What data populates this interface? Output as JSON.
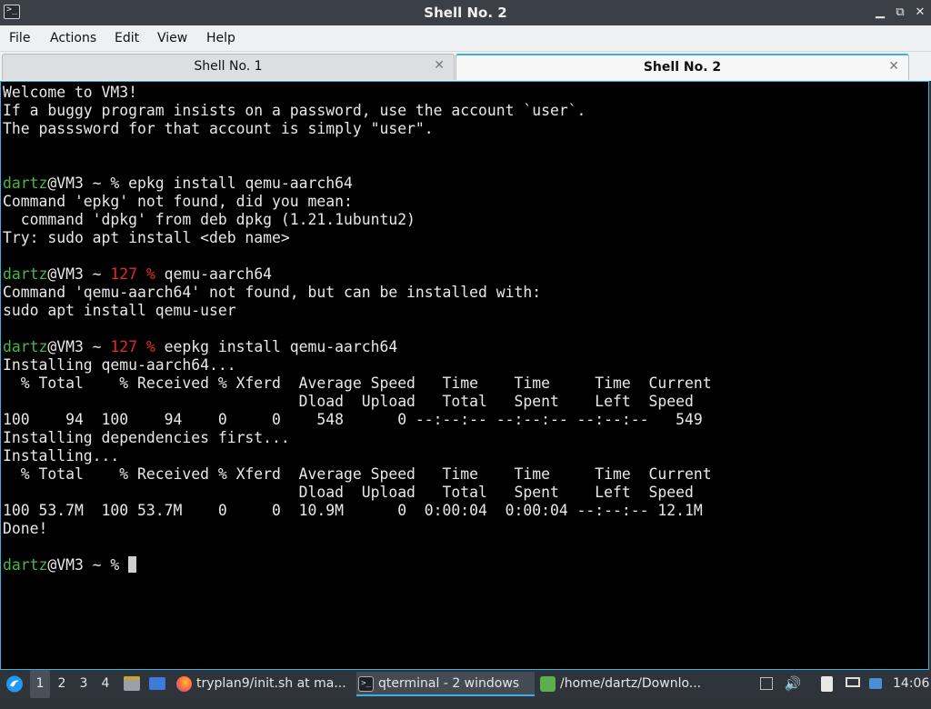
{
  "window": {
    "title": "Shell No. 2",
    "app_icon_glyph": ">_",
    "buttons": {
      "minimize": "▁",
      "restore": "⧉",
      "close": "✕"
    }
  },
  "menu": [
    "File",
    "Actions",
    "Edit",
    "View",
    "Help"
  ],
  "tabs": [
    {
      "label": "Shell No. 1",
      "active": false,
      "close": "✕"
    },
    {
      "label": "Shell No. 2",
      "active": true,
      "close": "✕"
    }
  ],
  "terminal": {
    "lines": [
      [
        {
          "t": "Welcome to VM3!"
        }
      ],
      [
        {
          "t": "If a buggy program insists on a password, use the account `user`."
        }
      ],
      [
        {
          "t": "The passsword for that account is simply \"user\"."
        }
      ],
      [],
      [],
      [
        {
          "t": "dartz",
          "c": "g"
        },
        {
          "t": "@VM3 ~ % epkg install qemu-aarch64"
        }
      ],
      [
        {
          "t": "Command 'epkg' not found, did you mean:"
        }
      ],
      [
        {
          "t": "  command 'dpkg' from deb dpkg (1.21.1ubuntu2)"
        }
      ],
      [
        {
          "t": "Try: sudo apt install <deb name>"
        }
      ],
      [],
      [
        {
          "t": "dartz",
          "c": "g"
        },
        {
          "t": "@VM3 ~ "
        },
        {
          "t": "127 %",
          "c": "r"
        },
        {
          "t": " qemu-aarch64"
        }
      ],
      [
        {
          "t": "Command 'qemu-aarch64' not found, but can be installed with:"
        }
      ],
      [
        {
          "t": "sudo apt install qemu-user"
        }
      ],
      [],
      [
        {
          "t": "dartz",
          "c": "g"
        },
        {
          "t": "@VM3 ~ "
        },
        {
          "t": "127 %",
          "c": "r"
        },
        {
          "t": " eepkg install qemu-aarch64"
        }
      ],
      [
        {
          "t": "Installing qemu-aarch64..."
        }
      ],
      [
        {
          "t": "  % Total    % Received % Xferd  Average Speed   Time    Time     Time  Current"
        }
      ],
      [
        {
          "t": "                                 Dload  Upload   Total   Spent    Left  Speed"
        }
      ],
      [
        {
          "t": "100    94  100    94    0     0    548      0 --:--:-- --:--:-- --:--:--   549"
        }
      ],
      [
        {
          "t": "Installing dependencies first..."
        }
      ],
      [
        {
          "t": "Installing..."
        }
      ],
      [
        {
          "t": "  % Total    % Received % Xferd  Average Speed   Time    Time     Time  Current"
        }
      ],
      [
        {
          "t": "                                 Dload  Upload   Total   Spent    Left  Speed"
        }
      ],
      [
        {
          "t": "100 53.7M  100 53.7M    0     0  10.9M      0  0:00:04  0:00:04 --:--:-- 12.1M"
        }
      ],
      [
        {
          "t": "Done!"
        }
      ],
      [],
      [
        {
          "t": "dartz",
          "c": "g"
        },
        {
          "t": "@VM3 ~ % "
        }
      ]
    ],
    "colors": {
      "prompt_user": "#4bb543",
      "error_code": "#e32b2b",
      "text": "#e8e8e8",
      "background": "#000000"
    }
  },
  "taskbar": {
    "workspaces": [
      "1",
      "2",
      "3",
      "4"
    ],
    "active_workspace": "1",
    "tasks": [
      {
        "label": "tryplan9/init.sh at ma...",
        "icon": "firefox-icon"
      },
      {
        "label": "qterminal - 2 windows",
        "icon": "terminal-icon",
        "active": true
      },
      {
        "label": "/home/dartz/Downlo...",
        "icon": "folder-icon"
      }
    ],
    "clock": "14:06"
  }
}
